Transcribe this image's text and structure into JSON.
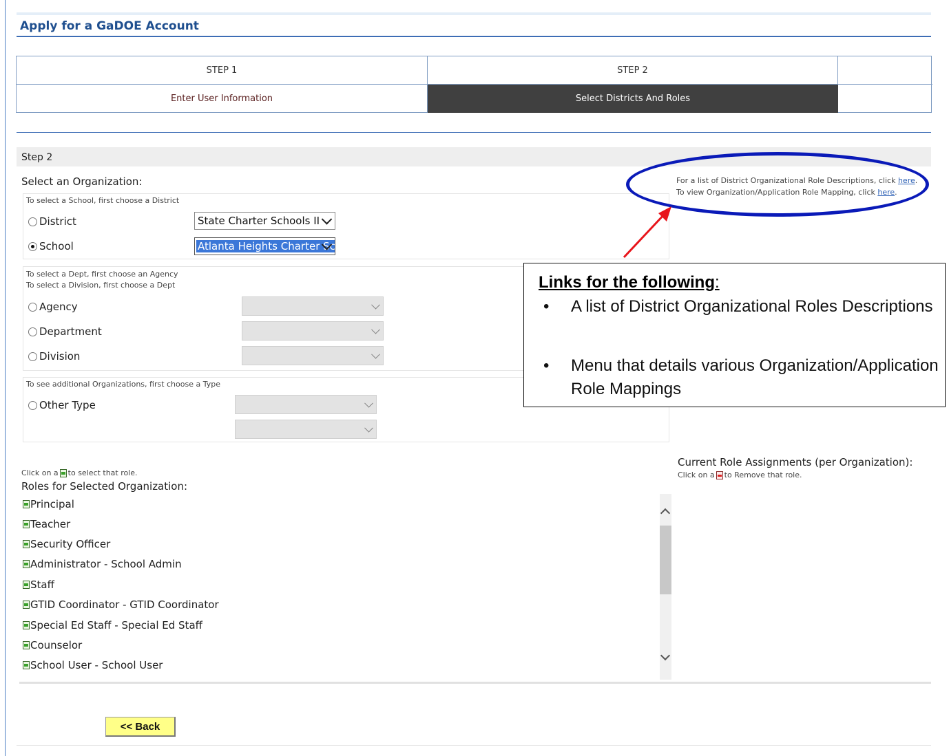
{
  "page": {
    "title": "Apply for a GaDOE Account"
  },
  "steps": [
    {
      "header": "STEP 1",
      "label": "Enter User Information",
      "active": false
    },
    {
      "header": "STEP 2",
      "label": "Select Districts And Roles",
      "active": true
    },
    {
      "header": "",
      "label": "",
      "active": false
    }
  ],
  "step2": {
    "label": "Step 2",
    "select_org_label": "Select an Organization:",
    "district_group": {
      "hint": "To select a School, first choose a District",
      "district_label": "District",
      "district_value": "State Charter Schools II",
      "school_label": "School",
      "school_value": "Atlanta Heights Charter Schoo",
      "selected": "School"
    },
    "agency_group": {
      "hint_line1": "To select a Dept, first choose an Agency",
      "hint_line2": "To select a Division, first choose a Dept",
      "agency_label": "Agency",
      "department_label": "Department",
      "division_label": "Division"
    },
    "other_group": {
      "hint": "To see additional Organizations, first choose a Type",
      "other_label": "Other Type"
    }
  },
  "links": {
    "line1_text": "For a list of District Organizational Role Descriptions, click ",
    "line1_link": "here",
    "line2_text": "To view Organization/Application Role Mapping, click ",
    "line2_link": "here",
    "period": "."
  },
  "callout": {
    "title": "Links for the following",
    "title_colon": ":",
    "items": [
      "A list of District Organizational Roles Descriptions",
      "Menu that details various Organization/Application Role Mappings"
    ],
    "bullet": "•"
  },
  "roles": {
    "click_hint_before": "Click on a",
    "click_hint_after": "to select that role.",
    "heading": "Roles for Selected Organization:",
    "items": [
      "Principal",
      "Teacher",
      "Security Officer",
      "Administrator - School Admin",
      "Staff",
      "GTID Coordinator - GTID Coordinator",
      "Special Ed Staff - Special Ed Staff",
      "Counselor",
      "School User - School User"
    ]
  },
  "current": {
    "heading": "Current Role Assignments (per Organization):",
    "hint_before": "Click on a",
    "hint_after": "to Remove that role."
  },
  "footer": {
    "back_label": "<< Back"
  },
  "colors": {
    "title": "#1f4f8f",
    "active_step_bg": "#404040",
    "ellipse": "#0a1ab8",
    "arrow": "#e8141a",
    "back_button": "#ffff88"
  }
}
